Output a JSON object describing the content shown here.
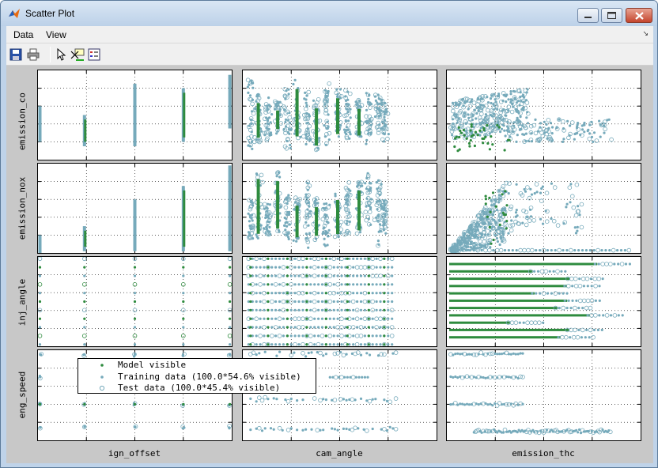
{
  "window": {
    "title": "Scatter Plot",
    "buttons": [
      "minimize",
      "maximize",
      "close"
    ]
  },
  "menu": {
    "items": [
      {
        "label": "Data"
      },
      {
        "label": "View"
      }
    ]
  },
  "toolbar": {
    "icons": [
      "save-icon",
      "print-icon",
      "select-arrow-icon",
      "data-cursor-icon",
      "legend-icon"
    ]
  },
  "colors": {
    "model": "#2e8b3e",
    "training": "#76aabb",
    "test": "#76aabb",
    "figure_bg": "#c8c8c8",
    "grid": "#000000"
  },
  "matrix": {
    "rows": [
      "emission_co",
      "emission_nox",
      "inj_angle",
      "eng_speed"
    ],
    "cols": [
      "ign_offset",
      "cam_angle",
      "emission_thc"
    ]
  },
  "legend": {
    "entries": [
      {
        "label": "Model visible",
        "marker": "dot",
        "color": "#2e8b3e"
      },
      {
        "label": "Training data (100.0*54.6% visible)",
        "marker": "dot",
        "color": "#76aabb"
      },
      {
        "label": "Test data (100.0*45.4% visible)",
        "marker": "circle",
        "color": "#76aabb"
      }
    ]
  },
  "chart_data": {
    "type": "scatter",
    "title": "",
    "x_variables": [
      "ign_offset",
      "cam_angle",
      "emission_thc"
    ],
    "y_variables": [
      "emission_co",
      "emission_nox",
      "inj_angle",
      "eng_speed"
    ],
    "series": [
      {
        "name": "Model visible",
        "marker": "dot",
        "color": "#2e8b3e"
      },
      {
        "name": "Training data (100.0*54.6% visible)",
        "marker": "dot",
        "color": "#76aabb"
      },
      {
        "name": "Test data (100.0*45.4% visible)",
        "marker": "circle",
        "color": "#76aabb"
      }
    ],
    "tick_labels_shown": false,
    "grid": true,
    "legend_position": "inside bottom-left panel (eng_speed vs ign_offset / cam_angle)"
  }
}
